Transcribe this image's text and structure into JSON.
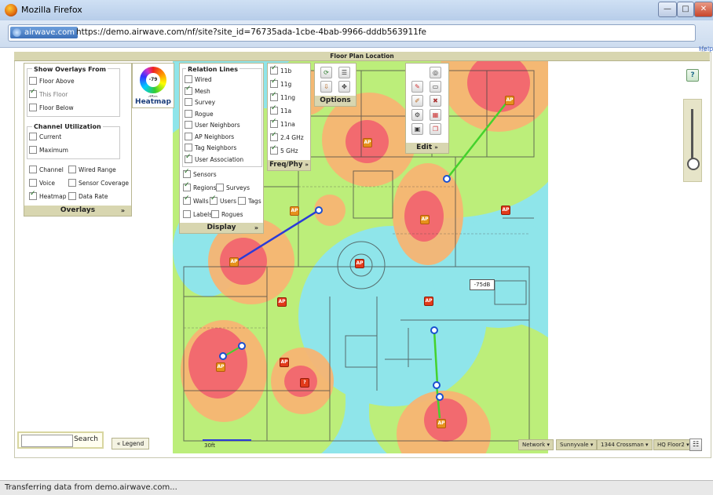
{
  "window": {
    "title": "Mozilla Firefox",
    "minimize": "—",
    "maximize": "□",
    "close": "✕"
  },
  "address": {
    "site_badge": "airwave.com",
    "url": "https://demo.airwave.com/nf/site?site_id=76735ada-1cbe-4bab-9966-dddb563911fe"
  },
  "help_link": "Help",
  "floor_plan_title": "Floor Plan Location",
  "overlays": {
    "show_from_title": "Show Overlays From",
    "floor_above": "Floor Above",
    "this_floor": "This Floor",
    "floor_below": "Floor Below",
    "channel_util_title": "Channel Utilization",
    "current": "Current",
    "maximum": "Maximum",
    "channel": "Channel",
    "wired_range": "Wired Range",
    "voice": "Voice",
    "sensor_coverage": "Sensor Coverage",
    "heatmap": "Heatmap",
    "data_rate": "Data Rate",
    "footer": "Overlays",
    "collapse": "»"
  },
  "heatmap_widget": {
    "label": "Heatmap",
    "dial_value": "-79",
    "dial_bottom": "dBm"
  },
  "relation_lines": {
    "title": "Relation Lines",
    "items": [
      "Wired",
      "Mesh",
      "Survey",
      "Rogue",
      "User Neighbors",
      "AP Neighbors",
      "Tag Neighbors",
      "User Association"
    ],
    "checked": [
      false,
      true,
      false,
      false,
      false,
      false,
      false,
      true
    ]
  },
  "display": {
    "sensors": "Sensors",
    "regions": "Regions",
    "surveys": "Surveys",
    "walls": "Walls",
    "users": "Users",
    "tags": "Tags",
    "labels": "Labels",
    "rogues": "Rogues",
    "footer": "Display",
    "collapse": "»"
  },
  "freq": {
    "items": [
      "11b",
      "11g",
      "11ng",
      "11a",
      "11na",
      "2.4 GHz",
      "5 GHz"
    ],
    "footer": "Freq/Phy",
    "collapse": "»"
  },
  "options": {
    "footer": "Options"
  },
  "edit": {
    "footer": "Edit",
    "collapse": "»"
  },
  "map": {
    "signal_tooltip": "-75dB",
    "scale_label": "30ft"
  },
  "help_icon": "?",
  "search": {
    "button": "Search",
    "placeholder": ""
  },
  "legend_tab": "Legend",
  "breadcrumbs": [
    "Network",
    "Sunnyvale",
    "1344 Crossman",
    "HQ Floor2"
  ],
  "status": "Transferring data from demo.airwave.com..."
}
